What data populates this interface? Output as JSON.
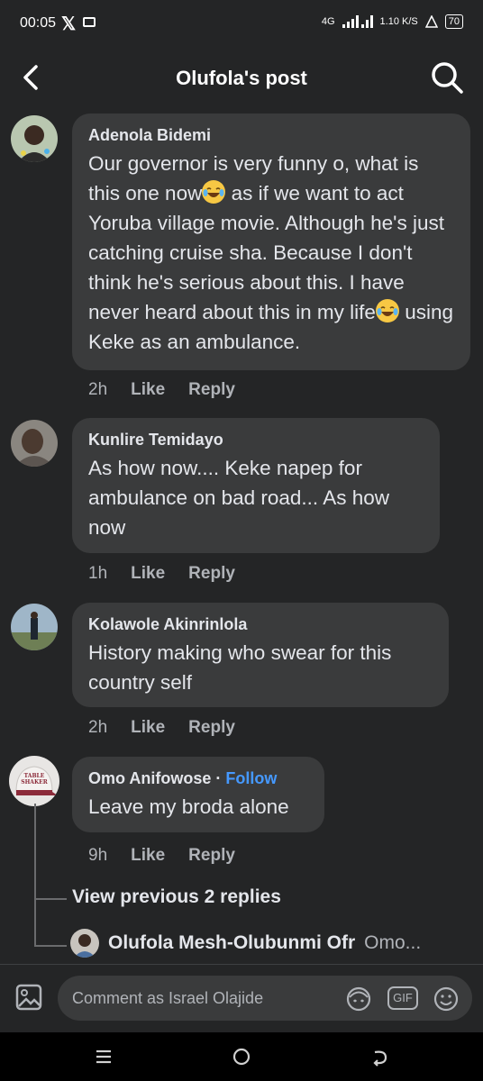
{
  "status_bar": {
    "time": "00:05",
    "network": "4G",
    "speed": "1.10 K/S",
    "battery": "70"
  },
  "header": {
    "title": "Olufola's post"
  },
  "comments": [
    {
      "name": "Adenola Bidemi",
      "text_parts": [
        "Our governor is very funny o, what is this one now",
        " as if we want to act Yoruba village movie. Although he's just catching cruise sha. Because I don't think he's serious about this. I have never heard about this in my life",
        " using Keke as an ambulance."
      ],
      "time": "2h",
      "like": "Like",
      "reply": "Reply"
    },
    {
      "name": "Kunlire Temidayo",
      "text": "As how now.... Keke napep for ambulance on bad road... As how now",
      "time": "1h",
      "like": "Like",
      "reply": "Reply"
    },
    {
      "name": "Kolawole Akinrinlola",
      "text": "History making who swear for this country self",
      "time": "2h",
      "like": "Like",
      "reply": "Reply"
    },
    {
      "name": "Omo Anifowose",
      "separator": "·",
      "follow": "Follow",
      "text": "Leave my broda alone",
      "time": "9h",
      "like": "Like",
      "reply": "Reply",
      "avatar_text": "TABLE SHAKER"
    }
  ],
  "thread": {
    "view_previous": "View previous 2 replies",
    "reply_name": "Olufola Mesh-Olubunmi Ofr",
    "reply_preview": "Omo..."
  },
  "composer": {
    "placeholder": "Comment as Israel Olajide",
    "gif_label": "GIF"
  },
  "colors": {
    "background": "#242526",
    "bubble": "#3a3b3c",
    "follow": "#4599ff",
    "meta": "#b0b3b8"
  }
}
